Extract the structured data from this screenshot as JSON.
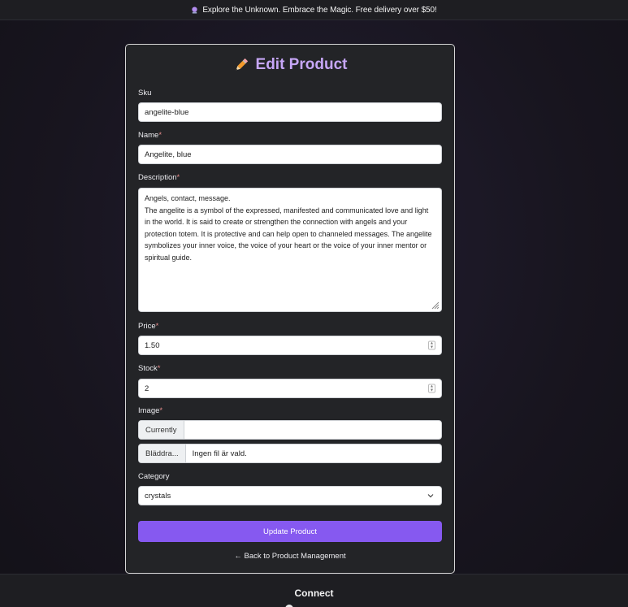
{
  "banner": {
    "icon": "crystal-ball-icon",
    "text": "Explore the Unknown. Embrace the Magic. Free delivery over $50!"
  },
  "form": {
    "title_icon": "pencil-icon",
    "title": "Edit Product",
    "sku": {
      "label": "Sku",
      "value": "angelite-blue"
    },
    "name": {
      "label": "Name",
      "required": "*",
      "value": "Angelite, blue"
    },
    "description": {
      "label": "Description",
      "required": "*",
      "value": "Angels, contact, message.\nThe angelite is a symbol of the expressed, manifested and communicated love and light in the world. It is said to create or strengthen the connection with angels and your protection totem. It is protective and can help open to channeled messages. The angelite symbolizes your inner voice, the voice of your heart or the voice of your inner mentor or spiritual guide."
    },
    "price": {
      "label": "Price",
      "required": "*",
      "value": "1.50"
    },
    "stock": {
      "label": "Stock",
      "required": "*",
      "value": "2"
    },
    "image": {
      "label": "Image",
      "required": "*",
      "currently_label": "Currently",
      "currently_value": "",
      "browse_label": "Bläddra...",
      "file_status": "Ingen fil är vald."
    },
    "category": {
      "label": "Category",
      "selected": "crystals"
    },
    "submit_label": "Update Product",
    "back_link": "← Back to Product Management"
  },
  "footer": {
    "heading": "Connect"
  },
  "colors": {
    "accent": "#8659f0",
    "title": "#c6a6f7",
    "card_bg": "#232427"
  }
}
